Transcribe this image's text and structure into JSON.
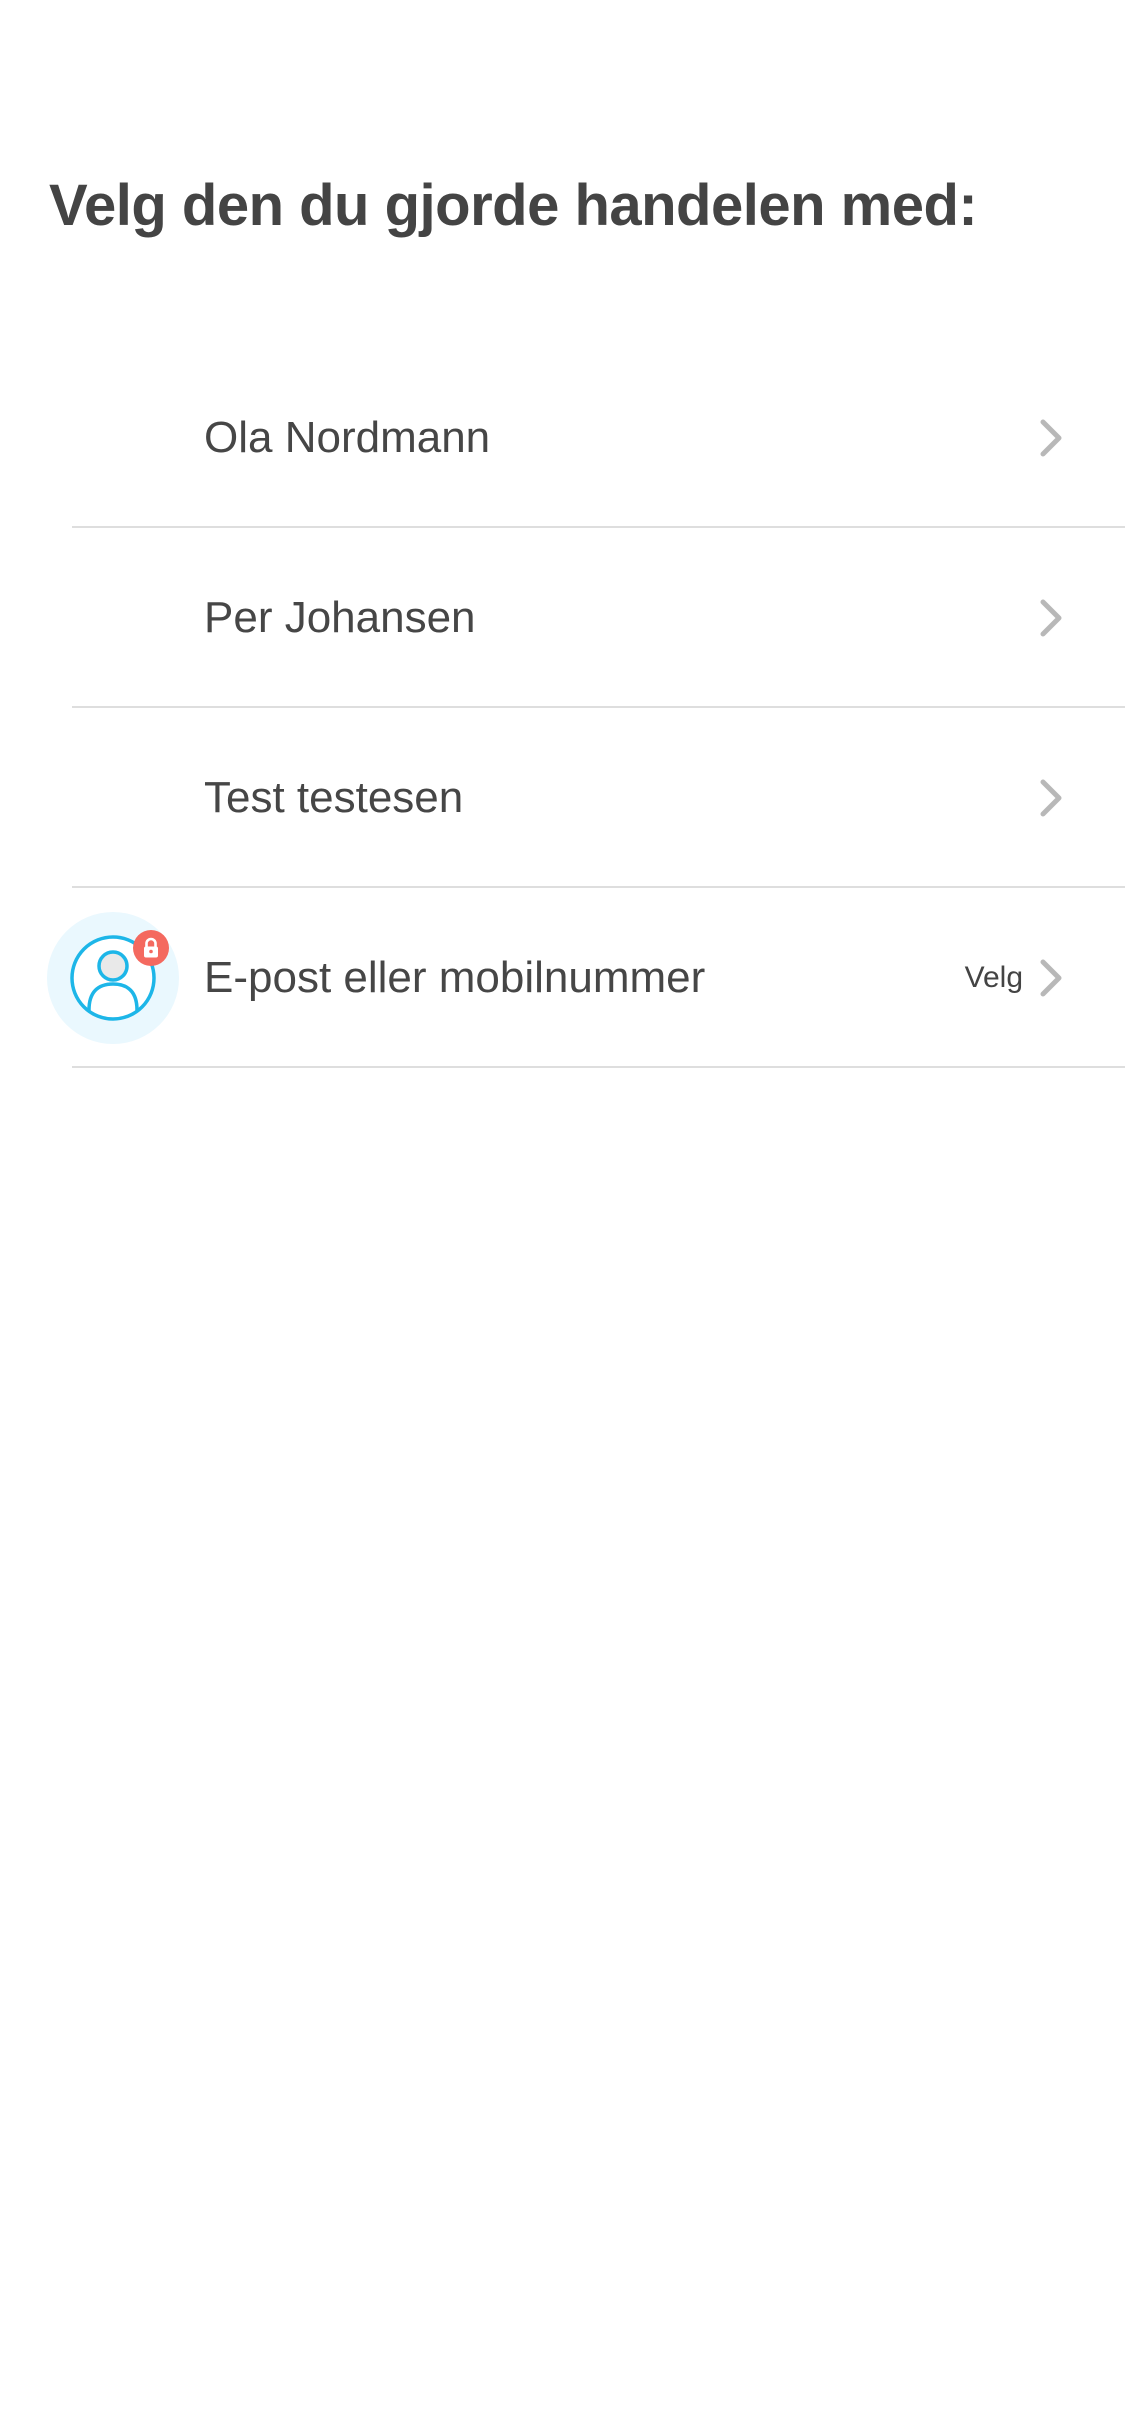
{
  "page": {
    "title": "Velg den du gjorde handelen med:"
  },
  "contacts": [
    {
      "name": "Ola Nordmann",
      "icon": "chevron-right-icon"
    },
    {
      "name": "Per Johansen",
      "icon": "chevron-right-icon"
    },
    {
      "name": "Test testesen",
      "icon": "chevron-right-icon"
    }
  ],
  "other_option": {
    "label": "E-post eller mobilnummer",
    "action_label": "Velg",
    "avatar_icon": "user-icon",
    "badge_icon": "lock-icon",
    "chevron_icon": "chevron-right-icon"
  },
  "colors": {
    "text": "#444444",
    "divider": "#dedede",
    "chevron": "#b8b8b8",
    "avatar_accent": "#1db6e8",
    "avatar_background": "#eaf8fe",
    "badge": "#f4695f"
  }
}
